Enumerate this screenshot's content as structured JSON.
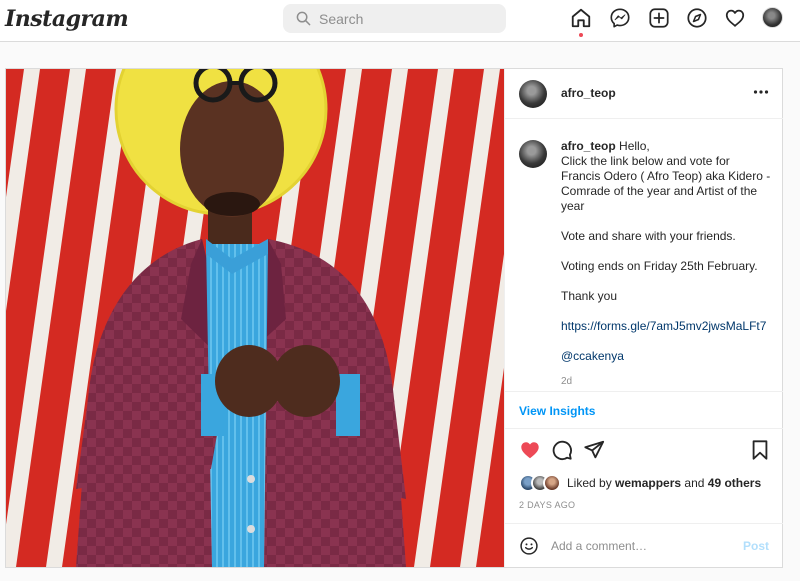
{
  "app": {
    "logo_text": "Instagram"
  },
  "search": {
    "placeholder": "Search",
    "icon": "search-icon"
  },
  "nav": {
    "items": [
      {
        "name": "home",
        "icon": "home-icon",
        "active": true
      },
      {
        "name": "direct",
        "icon": "messenger-icon"
      },
      {
        "name": "new-post",
        "icon": "plus-square-icon"
      },
      {
        "name": "explore",
        "icon": "compass-icon"
      },
      {
        "name": "activity",
        "icon": "heart-icon"
      },
      {
        "name": "profile",
        "icon": "profile-avatar"
      }
    ]
  },
  "post": {
    "username": "afro_teop",
    "caption": {
      "username": "afro_teop",
      "text": "Hello,\nClick the link below and vote for Francis Odero ( Afro Teop) aka Kidero - Comrade of the year and Artist of the year\n\nVote and share with your friends.\n\nVoting ends on Friday 25th February.\n\nThank you\n\n",
      "link": "https://forms.gle/7amJ5mv2jwsMaLFt7",
      "mention": "@ccakenya",
      "time": "2d"
    },
    "insights_label": "View Insights",
    "liked_by_prefix": "Liked by ",
    "liked_by_user": "wemappers",
    "liked_by_and": " and ",
    "liked_by_others": "49 others",
    "date": "2 DAYS AGO",
    "comment_placeholder": "Add a comment…",
    "post_button": "Post"
  },
  "colors": {
    "like_red": "#ed4956",
    "link_blue": "#00376b",
    "accent_blue": "#0095f6",
    "post_disabled": "#b2dffc"
  }
}
